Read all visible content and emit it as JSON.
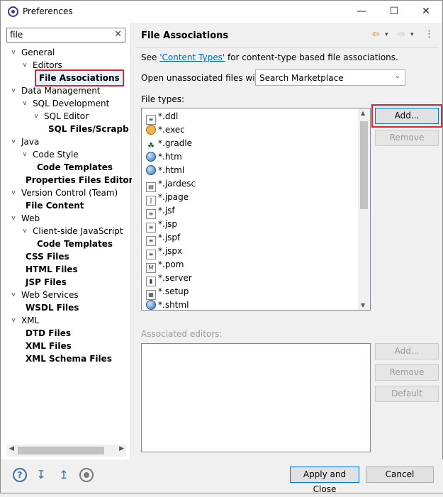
{
  "window": {
    "title": "Preferences",
    "controls": {
      "minimize": "—",
      "maximize": "☐",
      "close": "✕"
    }
  },
  "sidebar": {
    "filter": {
      "value": "file",
      "clear": "✕"
    },
    "tree": [
      {
        "label": "General",
        "level": 0,
        "expanded": true,
        "bold": false
      },
      {
        "label": "Editors",
        "level": 1,
        "expanded": true,
        "bold": false
      },
      {
        "label": "File Associations",
        "level": 2,
        "leaf": true,
        "bold": true,
        "selected": true
      },
      {
        "label": "Data Management",
        "level": 0,
        "expanded": true,
        "bold": false
      },
      {
        "label": "SQL Development",
        "level": 1,
        "expanded": true,
        "bold": false
      },
      {
        "label": "SQL Editor",
        "level": 2,
        "expanded": true,
        "bold": false
      },
      {
        "label": "SQL Files/Scrapb",
        "level": 3,
        "leaf": true,
        "bold": true
      },
      {
        "label": "Java",
        "level": 0,
        "expanded": true,
        "bold": false
      },
      {
        "label": "Code Style",
        "level": 1,
        "expanded": true,
        "bold": false
      },
      {
        "label": "Code Templates",
        "level": 2,
        "leaf": true,
        "bold": true
      },
      {
        "label": "Properties Files Editor",
        "level": 1,
        "leaf": true,
        "bold": true
      },
      {
        "label": "Version Control (Team)",
        "level": 0,
        "expanded": true,
        "bold": false
      },
      {
        "label": "File Content",
        "level": 1,
        "leaf": true,
        "bold": true
      },
      {
        "label": "Web",
        "level": 0,
        "expanded": true,
        "bold": false
      },
      {
        "label": "Client-side JavaScript",
        "level": 1,
        "expanded": true,
        "bold": false
      },
      {
        "label": "Code Templates",
        "level": 2,
        "leaf": true,
        "bold": true
      },
      {
        "label": "CSS Files",
        "level": 1,
        "leaf": true,
        "bold": true
      },
      {
        "label": "HTML Files",
        "level": 1,
        "leaf": true,
        "bold": true
      },
      {
        "label": "JSP Files",
        "level": 1,
        "leaf": true,
        "bold": true
      },
      {
        "label": "Web Services",
        "level": 0,
        "expanded": true,
        "bold": false
      },
      {
        "label": "WSDL Files",
        "level": 1,
        "leaf": true,
        "bold": true
      },
      {
        "label": "XML",
        "level": 0,
        "expanded": true,
        "bold": false
      },
      {
        "label": "DTD Files",
        "level": 1,
        "leaf": true,
        "bold": true
      },
      {
        "label": "XML Files",
        "level": 1,
        "leaf": true,
        "bold": true
      },
      {
        "label": "XML Schema Files",
        "level": 1,
        "leaf": true,
        "bold": true
      }
    ]
  },
  "main": {
    "heading": "File Associations",
    "nav_icons": {
      "back": "⇦",
      "back_menu": "▾",
      "forward": "⇨",
      "forward_menu": "▾",
      "more": "⋮"
    },
    "info_prefix": "See ",
    "info_link": "'Content Types'",
    "info_suffix": " for content-type based file associations.",
    "open_label": "Open unassociated files with:",
    "open_value": "Search Marketplace",
    "file_types_label": "File types:",
    "file_types": [
      {
        "name": "*.ddl",
        "icon": "doc"
      },
      {
        "name": "*.exec",
        "icon": "gear"
      },
      {
        "name": "*.gradle",
        "icon": "gradle"
      },
      {
        "name": "*.htm",
        "icon": "globe"
      },
      {
        "name": "*.html",
        "icon": "globe"
      },
      {
        "name": "*.jardesc",
        "icon": "jar"
      },
      {
        "name": "*.jpage",
        "icon": "java"
      },
      {
        "name": "*.jsf",
        "icon": "doc"
      },
      {
        "name": "*.jsp",
        "icon": "doc"
      },
      {
        "name": "*.jspf",
        "icon": "doc"
      },
      {
        "name": "*.jspx",
        "icon": "doc"
      },
      {
        "name": "*.pom",
        "icon": "maven"
      },
      {
        "name": "*.server",
        "icon": "server"
      },
      {
        "name": "*.setup",
        "icon": "setup"
      },
      {
        "name": "*.shtml",
        "icon": "globe"
      }
    ],
    "file_types_buttons": {
      "add": "Add...",
      "remove": "Remove"
    },
    "associated_editors_label": "Associated editors:",
    "editors_buttons": {
      "add": "Add...",
      "remove": "Remove",
      "default": "Default"
    }
  },
  "bottom": {
    "icons": [
      "help-icon",
      "import-icon",
      "export-icon",
      "record-icon"
    ],
    "apply_close": "Apply and Close",
    "cancel": "Cancel"
  }
}
